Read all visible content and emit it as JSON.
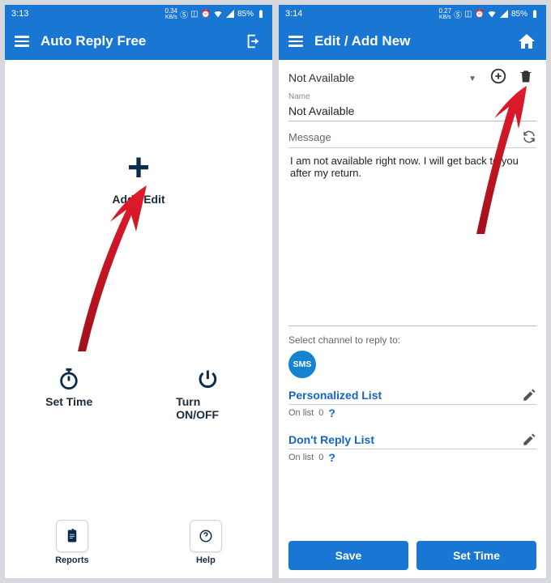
{
  "screen1": {
    "status": {
      "time": "3:13",
      "net_speed": "0.34",
      "net_unit": "KB/s",
      "battery": "85%"
    },
    "appbar": {
      "title": "Auto Reply Free"
    },
    "tiles": {
      "add_edit": "Add / Edit",
      "set_time": "Set Time",
      "turn_onoff": "Turn ON/OFF"
    },
    "bottom": {
      "reports": "Reports",
      "help": "Help"
    }
  },
  "screen2": {
    "status": {
      "time": "3:14",
      "net_speed": "0.27",
      "net_unit": "KB/s",
      "battery": "85%"
    },
    "appbar": {
      "title": "Edit / Add New"
    },
    "dropdown_value": "Not Available",
    "name_label": "Name",
    "name_value": "Not Available",
    "message_label": "Message",
    "message_value": "I am not available right now. I will get back to you after my return.",
    "channel_label": "Select channel to reply to:",
    "channel_chip": "SMS",
    "personalized_title": "Personalized List",
    "dont_reply_title": "Don't Reply List",
    "onlist_prefix": "On list",
    "onlist_count": "0",
    "buttons": {
      "save": "Save",
      "set_time": "Set Time"
    }
  }
}
